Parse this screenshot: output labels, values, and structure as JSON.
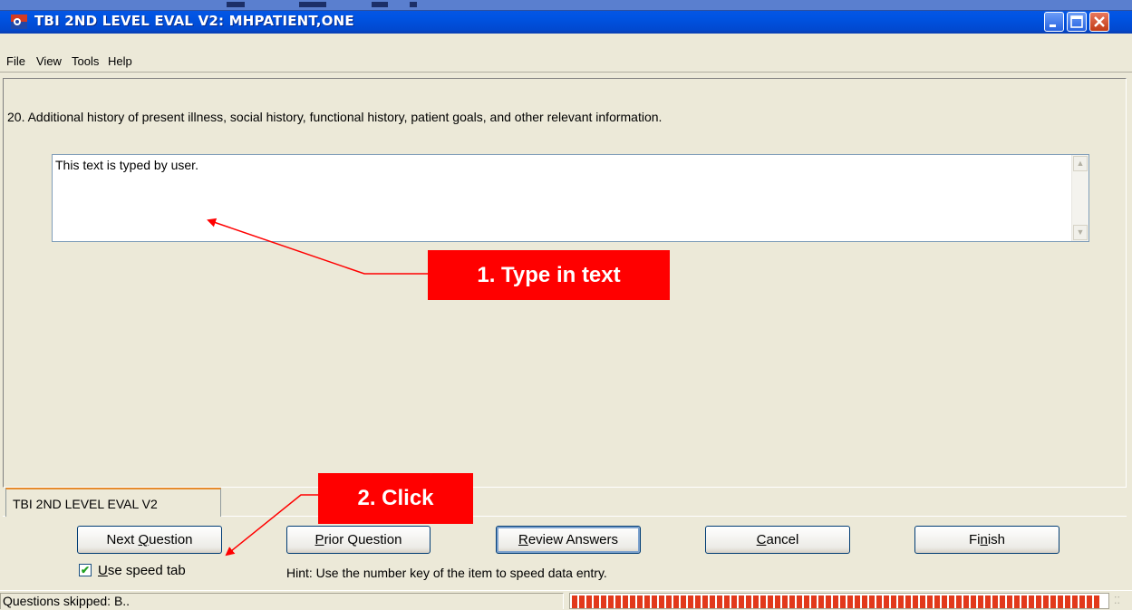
{
  "window": {
    "title": "TBI 2ND LEVEL EVAL V2: MHPATIENT,ONE",
    "controls": [
      "minimize",
      "maximize",
      "close"
    ]
  },
  "menu": [
    "File",
    "View",
    "Tools",
    "Help"
  ],
  "question": {
    "text": "20. Additional history of present illness, social history, functional history, patient goals, and other relevant information.",
    "answer_text": "This text is typed by user."
  },
  "tab": {
    "label": "TBI 2ND LEVEL EVAL V2"
  },
  "buttons": {
    "next": {
      "label": "Next Question",
      "mnemonic": "Q"
    },
    "prior": {
      "label": "Prior Question",
      "mnemonic": "P"
    },
    "review": {
      "label": "Review Answers",
      "mnemonic": "R"
    },
    "cancel": {
      "label": "Cancel",
      "mnemonic": "C"
    },
    "finish": {
      "label": "Finish",
      "mnemonic": "i"
    }
  },
  "speed_tab": {
    "label": "Use speed tab",
    "checked": true
  },
  "hint": "Hint: Use the number key of the item to speed data entry.",
  "status": {
    "text": "Questions skipped: B..",
    "progress_fraction": 0.98
  },
  "annotations": {
    "step1": "1. Type in text",
    "step2": "2. Click"
  },
  "colors": {
    "titlebar": "#0054e3",
    "window_bg": "#ece9d8",
    "callout": "#ff0000",
    "progress": "#e2391b"
  },
  "icons": {
    "app": "app-icon",
    "minimize": "minimize-icon",
    "maximize": "maximize-icon",
    "close": "close-icon",
    "check": "checkmark-icon"
  }
}
